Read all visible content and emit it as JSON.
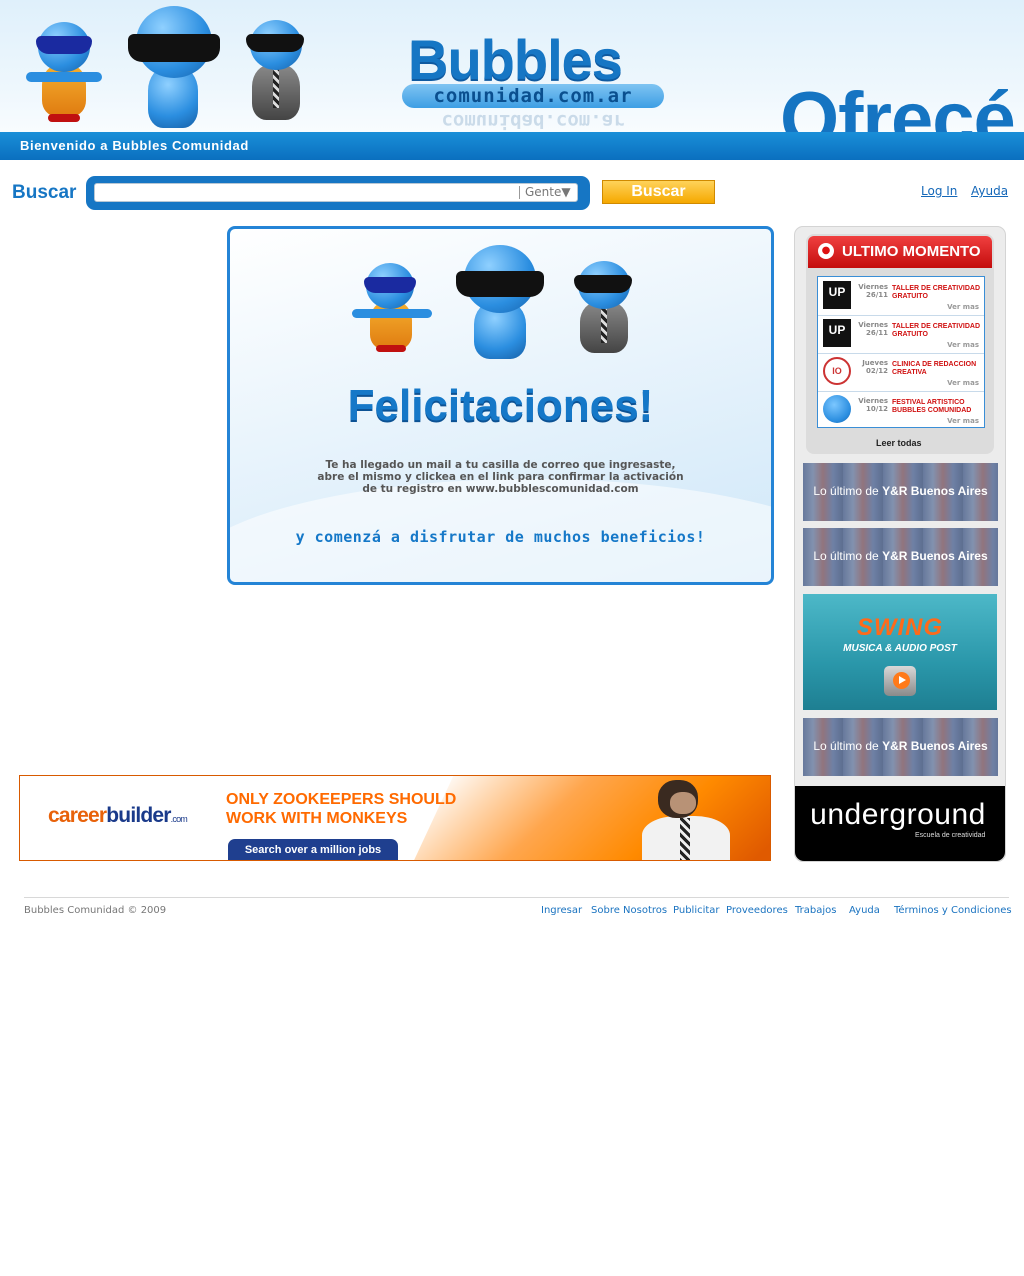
{
  "header": {
    "welcome": "Bienvenido a Bubbles Comunidad",
    "logo_main": "Bubbles",
    "logo_sub": "comunidad.com.ar",
    "slogan": "Ofrecé"
  },
  "search": {
    "label": "Buscar",
    "placeholder": "",
    "select_value": "Gente",
    "button": "Buscar"
  },
  "top_links": {
    "login": "Log In",
    "help": "Ayuda"
  },
  "main": {
    "title": "Felicitaciones!",
    "message_lines": [
      "Te ha llegado un mail a tu casilla de correo que ingresaste,",
      "abre el mismo y clickea en el link para confirmar la activación",
      "de tu registro en www.bubblescomunidad.com"
    ],
    "tagline": "y comenzá a disfrutar de muchos beneficios!"
  },
  "sidebar": {
    "ultimo_title": "ULTIMO MOMENTO",
    "news": [
      {
        "logo": "UP",
        "day": "Viernes",
        "date": "26/11",
        "text": "TALLER DE CREATIVIDAD GRATUITO",
        "more": "Ver mas"
      },
      {
        "logo": "UP",
        "day": "Viernes",
        "date": "26/11",
        "text": "TALLER DE CREATIVIDAD GRATUITO",
        "more": "Ver mas"
      },
      {
        "logo": "IO",
        "day": "Jueves",
        "date": "02/12",
        "text": "CLINICA DE REDACCION CREATIVA",
        "more": "Ver mas"
      },
      {
        "logo": "",
        "day": "Viernes",
        "date": "10/12",
        "text": "FESTIVAL ARTISTICO BUBBLES COMUNIDAD",
        "more": "Ver mas"
      }
    ],
    "read_all": "Leer todas",
    "yr_prefix": "Lo último de",
    "yr_name": "Y&R Buenos Aires",
    "swing_title": "SWING",
    "swing_sub": "MUSICA & AUDIO POST",
    "underground_title": "underground",
    "underground_sub": "Escuela de creatividad"
  },
  "ad": {
    "logo_a": "career",
    "logo_b": "builder",
    "logo_c": ".com",
    "line1": "ONLY ZOOKEEPERS SHOULD",
    "line2": "WORK WITH MONKEYS",
    "button": "Search over a million jobs"
  },
  "footer": {
    "copyright": "Bubbles Comunidad  © 2009",
    "links": [
      "Ingresar",
      "Sobre Nosotros",
      "Publicitar",
      "Proveedores",
      "Trabajos",
      "Ayuda",
      "Términos y Condiciones"
    ]
  },
  "colors": {
    "brand_blue": "#1676c4",
    "button_orange": "#f5a800",
    "alert_red": "#d01010"
  }
}
